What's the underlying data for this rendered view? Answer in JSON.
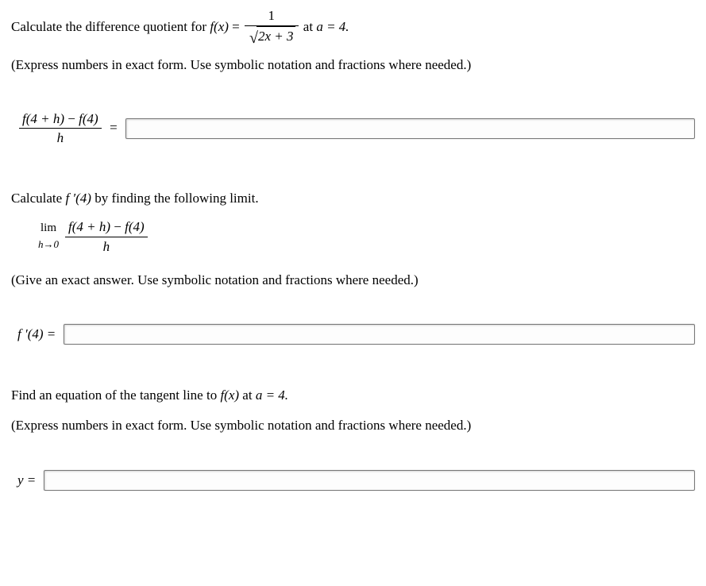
{
  "q1": {
    "prompt_prefix": "Calculate the difference quotient for ",
    "fx_label": "f(x)",
    "equals": " = ",
    "frac_num": "1",
    "frac_den_radicand": "2x + 3",
    "at_a": " at ",
    "a_eq": "a = 4.",
    "instructions": "(Express numbers in exact form. Use symbolic notation and fractions where needed.)",
    "dq_num_1": "f(4 + h)",
    "dq_minus": " − ",
    "dq_num_2": "f(4)",
    "dq_den": "h",
    "dq_equals": "="
  },
  "q2": {
    "prompt_prefix": "Calculate ",
    "fprime4": "f ′(4)",
    "prompt_mid": " by finding the following limit.",
    "lim_label": "lim",
    "lim_cond": "h→0",
    "frac_num_1": "f(4 + h)",
    "frac_minus": " − ",
    "frac_num_2": "f(4)",
    "frac_den": "h",
    "instructions": "(Give an exact answer. Use symbolic notation and fractions where needed.)",
    "label_fprime4": "f ′(4) ="
  },
  "q3": {
    "prompt_prefix": "Find an equation of the tangent line to ",
    "fx_label": "f(x)",
    "prompt_mid": " at ",
    "a_eq": "a = 4.",
    "instructions": "(Express numbers in exact form. Use symbolic notation and fractions where needed.)",
    "label_y": "y ="
  },
  "inputs": {
    "dq_value": "",
    "fprime4_value": "",
    "y_value": ""
  }
}
